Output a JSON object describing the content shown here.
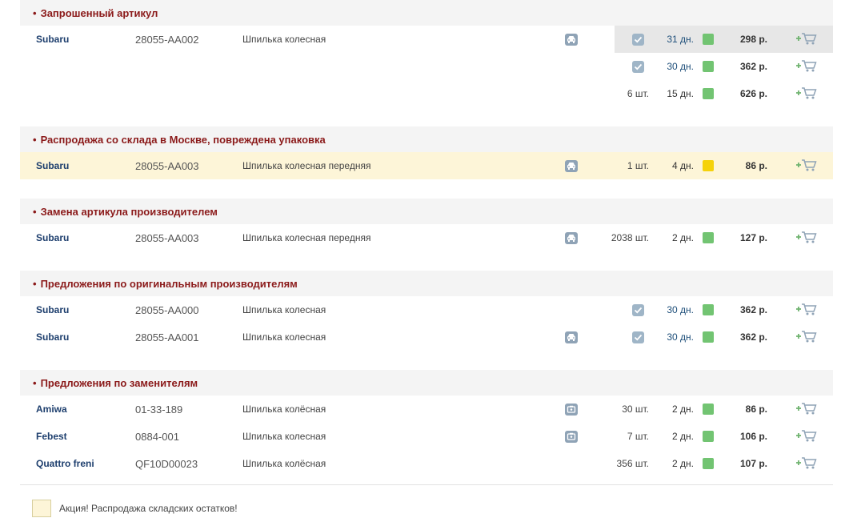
{
  "sections": [
    {
      "title": "Запрошенный артикул",
      "rows": [
        {
          "brand": "Subaru",
          "article": "28055-AA002",
          "description": "Шпилька колесная",
          "car": true,
          "qty": "",
          "check": true,
          "days": "31 дн.",
          "status": "green",
          "price": "298 р.",
          "highlight": true
        },
        {
          "brand": "",
          "article": "",
          "description": "",
          "car": false,
          "qty": "",
          "check": true,
          "days": "30 дн.",
          "status": "green",
          "price": "362 р."
        },
        {
          "brand": "",
          "article": "",
          "description": "",
          "car": false,
          "qty": "6 шт.",
          "check": false,
          "days": "15 дн.",
          "status": "green",
          "price": "626 р."
        }
      ]
    },
    {
      "title": "Распродажа со склада в Москве, повреждена упаковка",
      "rows": [
        {
          "brand": "Subaru",
          "article": "28055-AA003",
          "description": "Шпилька колесная передняя",
          "car": true,
          "qty": "1 шт.",
          "check": false,
          "days": "4 дн.",
          "status": "yellow",
          "price": "86 р.",
          "yellow": true
        }
      ]
    },
    {
      "title": "Замена артикула производителем",
      "rows": [
        {
          "brand": "Subaru",
          "article": "28055-AA003",
          "description": "Шпилька колесная передняя",
          "car": true,
          "qty": "2038 шт.",
          "check": false,
          "days": "2 дн.",
          "status": "green",
          "price": "127 р."
        }
      ]
    },
    {
      "title": "Предложения по оригинальным производителям",
      "rows": [
        {
          "brand": "Subaru",
          "article": "28055-AA000",
          "description": "Шпилька колесная",
          "car": false,
          "qty": "",
          "check": true,
          "days": "30 дн.",
          "status": "green",
          "price": "362 р."
        },
        {
          "brand": "Subaru",
          "article": "28055-AA001",
          "description": "Шпилька колесная",
          "car": true,
          "qty": "",
          "check": true,
          "days": "30 дн.",
          "status": "green",
          "price": "362 р."
        }
      ]
    },
    {
      "title": "Предложения по заменителям",
      "rows": [
        {
          "brand": "Amiwa",
          "article": "01-33-189",
          "description": "Шпилька колёсная",
          "car": "box",
          "qty": "30 шт.",
          "check": false,
          "days": "2 дн.",
          "status": "green",
          "price": "86 р."
        },
        {
          "brand": "Febest",
          "article": "0884-001",
          "description": "Шпилька колесная",
          "car": "box",
          "qty": "7 шт.",
          "check": false,
          "days": "2 дн.",
          "status": "green",
          "price": "106 р."
        },
        {
          "brand": "Quattro freni",
          "article": "QF10D00023",
          "description": "Шпилька колёсная",
          "car": false,
          "qty": "356 шт.",
          "check": false,
          "days": "2 дн.",
          "status": "green",
          "price": "107 р."
        }
      ]
    }
  ],
  "legend": {
    "text": "Акция! Распродажа складских остатков!"
  },
  "bullet": "•",
  "colors": {
    "section_title": "#8b1a1a",
    "brand": "#1e3f6e",
    "green": "#72c472",
    "yellow": "#f5d20a",
    "promo_bg": "#fdf5d8"
  },
  "icons": {
    "car": "car-icon",
    "box": "box-icon",
    "check": "check-icon",
    "cart": "add-to-cart-icon"
  }
}
